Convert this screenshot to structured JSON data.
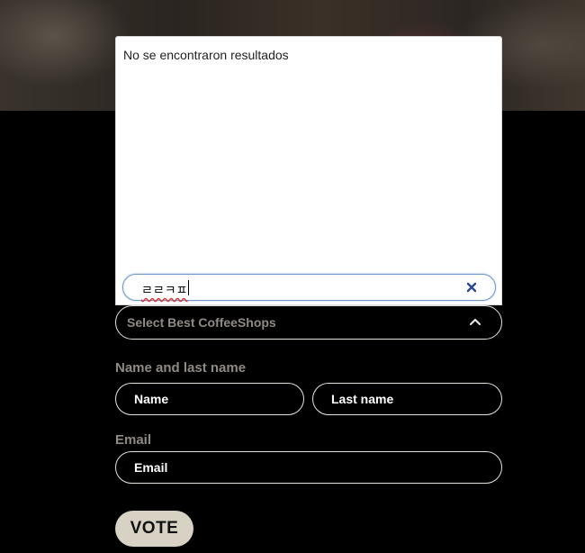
{
  "select": {
    "placeholder": "Select Best CoffeeShops",
    "no_results": "No se encontraron resultados",
    "search_value": "ㄹㄹㅋㅍ"
  },
  "form": {
    "name_section_label": "Name and last name",
    "name_placeholder": "Name",
    "last_name_placeholder": "Last name",
    "email_section_label": "Email",
    "email_placeholder": "Email",
    "submit_label": "VOTE"
  },
  "icons": {
    "select_toggle": "chevron-up-icon",
    "clear": "close-icon"
  },
  "colors": {
    "page_background": "#000000",
    "border": "#e7e2dc",
    "label": "#8f8a84",
    "vote_button": "#d8d2c4",
    "search_focus_border": "#6f95c8",
    "clear_icon": "#2a4a8a"
  }
}
